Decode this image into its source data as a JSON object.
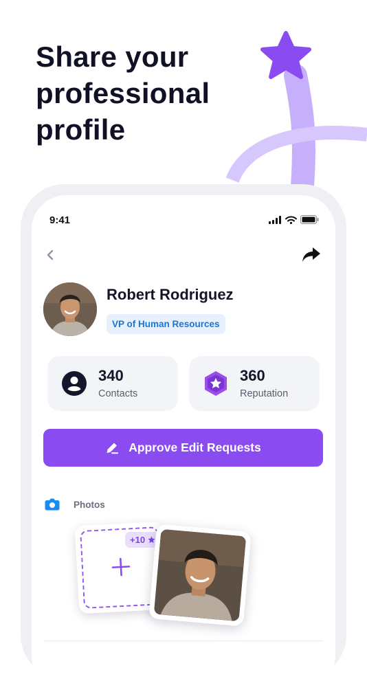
{
  "headline": {
    "line1": "Share your",
    "line2": "professional",
    "line3": "profile"
  },
  "status_bar": {
    "time": "9:41"
  },
  "profile": {
    "name": "Robert Rodriguez",
    "role": "VP of Human Resources",
    "stats": [
      {
        "value": "340",
        "label": "Contacts",
        "icon": "person-icon"
      },
      {
        "value": "360",
        "label": "Reputation",
        "icon": "star-hexagon-icon"
      }
    ]
  },
  "actions": {
    "approve_label": "Approve Edit Requests"
  },
  "photos": {
    "title": "Photos",
    "extra_count": "+10"
  },
  "colors": {
    "accent": "#8a4cf0",
    "accent_light": "#c9b0fb",
    "badge_bg": "#e6f1fd",
    "badge_text": "#1a76d2",
    "card_bg": "#f3f4f7",
    "camera_blue": "#1a8cf0"
  }
}
